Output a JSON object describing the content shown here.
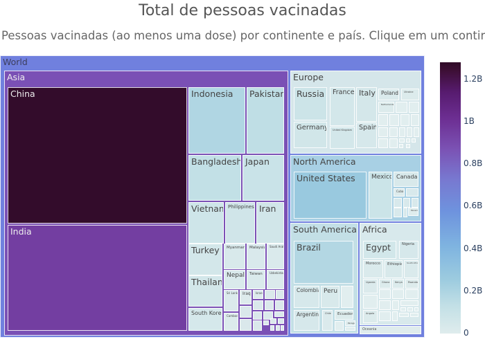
{
  "header": {
    "title": "Total de pessoas vacinadas",
    "subtitle": "Pessoas vacinadas (ao menos uma dose) por continente e país. Clique em um continente"
  },
  "chart_data": {
    "type": "treemap",
    "title": "Total de pessoas vacinadas",
    "subtitle": "Pessoas vacinadas (ao menos uma dose) por continente e país. Clique em um continente",
    "root": "World",
    "colorscale": [
      "#dfeced",
      "#9ccbdf",
      "#6e93de",
      "#7b52b4",
      "#571b6f",
      "#2f0b27"
    ],
    "colorbar": {
      "range": [
        0,
        1.28
      ],
      "unit": "B",
      "ticks": [
        "0",
        "0.2B",
        "0.4B",
        "0.6B",
        "0.8B",
        "1B",
        "1.2B"
      ]
    },
    "continents": [
      {
        "name": "Asia",
        "value_b": 3.1,
        "countries": [
          {
            "name": "China",
            "value_b": 1.27
          },
          {
            "name": "India",
            "value_b": 0.95
          },
          {
            "name": "Indonesia",
            "value_b": 0.19
          },
          {
            "name": "Pakistan",
            "value_b": 0.14
          },
          {
            "name": "Bangladesh",
            "value_b": 0.13
          },
          {
            "name": "Japan",
            "value_b": 0.1
          },
          {
            "name": "Vietnam",
            "value_b": 0.08
          },
          {
            "name": "Philippines",
            "value_b": 0.07
          },
          {
            "name": "Iran",
            "value_b": 0.065
          },
          {
            "name": "Turkey",
            "value_b": 0.057
          },
          {
            "name": "Myanmar",
            "value_b": 0.03
          },
          {
            "name": "Malaysia",
            "value_b": 0.027
          },
          {
            "name": "Saudi Arabia",
            "value_b": 0.025
          },
          {
            "name": "Thailand",
            "value_b": 0.055
          },
          {
            "name": "Nepal",
            "value_b": 0.022
          },
          {
            "name": "Taiwan",
            "value_b": 0.021
          },
          {
            "name": "Uzbekistan",
            "value_b": 0.02
          },
          {
            "name": "South Korea",
            "value_b": 0.044
          },
          {
            "name": "Sri Lanka",
            "value_b": 0.017
          },
          {
            "name": "Iraq",
            "value_b": 0.011
          },
          {
            "name": "Israel",
            "value_b": 0.007
          },
          {
            "name": "Cambodia",
            "value_b": 0.015
          }
        ]
      },
      {
        "name": "Europe",
        "value_b": 0.54,
        "countries": [
          {
            "name": "Russia",
            "value_b": 0.085
          },
          {
            "name": "Germany",
            "value_b": 0.065
          },
          {
            "name": "France",
            "value_b": 0.054
          },
          {
            "name": "United Kingdom",
            "value_b": 0.053
          },
          {
            "name": "Italy",
            "value_b": 0.05
          },
          {
            "name": "Spain",
            "value_b": 0.041
          },
          {
            "name": "Poland",
            "value_b": 0.023
          },
          {
            "name": "Ukraine",
            "value_b": 0.016
          },
          {
            "name": "Netherlands",
            "value_b": 0.013
          }
        ]
      },
      {
        "name": "North America",
        "value_b": 0.47,
        "countries": [
          {
            "name": "United States",
            "value_b": 0.27
          },
          {
            "name": "Mexico",
            "value_b": 0.09
          },
          {
            "name": "Canada",
            "value_b": 0.033
          },
          {
            "name": "Cuba",
            "value_b": 0.01
          },
          {
            "name": "Panama",
            "value_b": 0.003
          }
        ]
      },
      {
        "name": "South America",
        "value_b": 0.35,
        "countries": [
          {
            "name": "Brazil",
            "value_b": 0.18
          },
          {
            "name": "Colombia",
            "value_b": 0.043
          },
          {
            "name": "Peru",
            "value_b": 0.03
          },
          {
            "name": "Argentina",
            "value_b": 0.041
          },
          {
            "name": "Chile",
            "value_b": 0.018
          },
          {
            "name": "Ecuador",
            "value_b": 0.015
          },
          {
            "name": "Paraguay",
            "value_b": 0.004
          }
        ]
      },
      {
        "name": "Africa",
        "value_b": 0.3,
        "countries": [
          {
            "name": "Egypt",
            "value_b": 0.058
          },
          {
            "name": "Nigeria",
            "value_b": 0.04
          },
          {
            "name": "Morocco",
            "value_b": 0.025
          },
          {
            "name": "Ethiopia",
            "value_b": 0.03
          },
          {
            "name": "South Africa",
            "value_b": 0.022
          },
          {
            "name": "Uganda",
            "value_b": 0.017
          },
          {
            "name": "Ghana",
            "value_b": 0.013
          },
          {
            "name": "Kenya",
            "value_b": 0.014
          },
          {
            "name": "Rwanda",
            "value_b": 0.01
          },
          {
            "name": "Angola",
            "value_b": 0.015
          }
        ]
      },
      {
        "name": "Oceania",
        "value_b": 0.03,
        "countries": []
      }
    ]
  }
}
